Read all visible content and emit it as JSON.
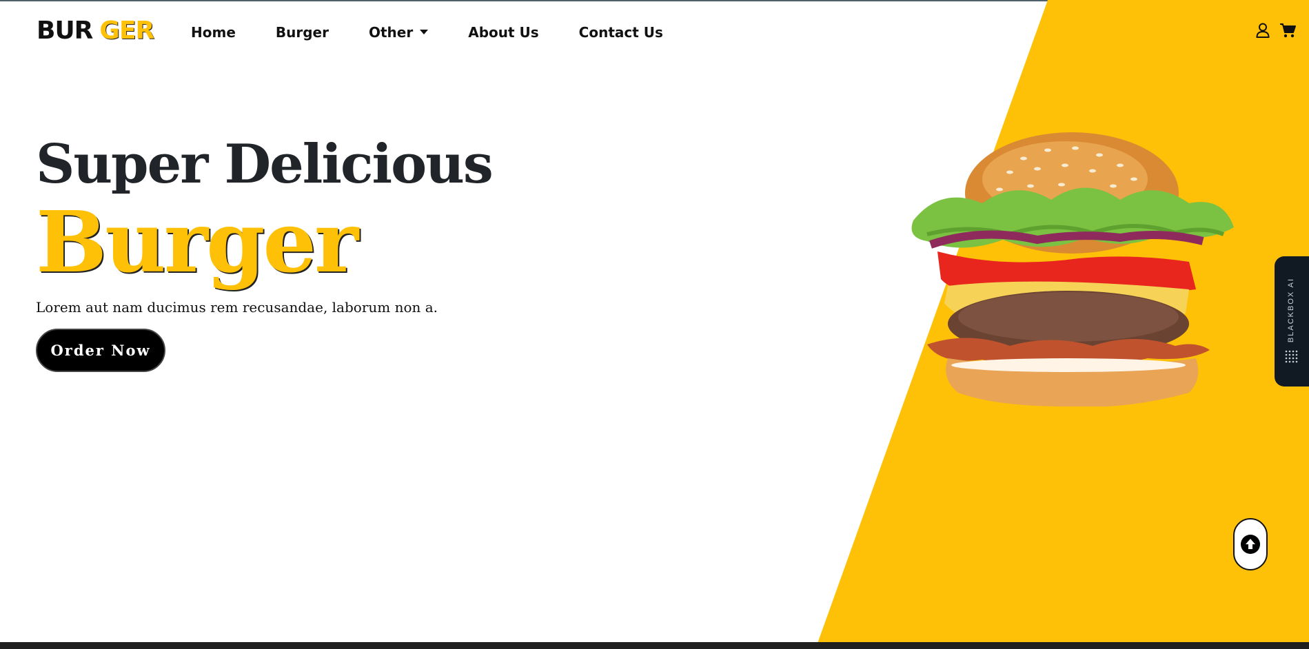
{
  "brand": {
    "part1": "BUR",
    "part2": "GER"
  },
  "nav": {
    "items": [
      {
        "label": "Home"
      },
      {
        "label": "Burger"
      },
      {
        "label": "Other"
      },
      {
        "label": "About Us"
      },
      {
        "label": "Contact Us"
      }
    ],
    "icons": [
      "user-icon",
      "cart-icon"
    ]
  },
  "hero": {
    "title_line1": "Super Delicious",
    "title_line2": "Burger",
    "description": "Lorem aut nam ducimus rem recusandae, laborum non a.",
    "cta_label": "Order Now",
    "image_icon": "burger-image"
  },
  "side_tab": {
    "label": "BLACKBOX AI"
  },
  "scroll_top": {
    "icon": "arrow-up-circle-icon"
  },
  "colors": {
    "accent": "#ffc107",
    "dark_text": "#212529",
    "button_bg": "#000000",
    "side_tab_bg": "#111a22"
  }
}
